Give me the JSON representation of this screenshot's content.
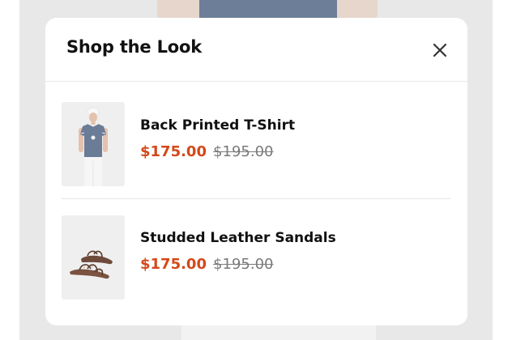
{
  "modal": {
    "title": "Shop the Look"
  },
  "products": [
    {
      "name": "Back Printed T-Shirt",
      "sale_price": "$175.00",
      "original_price": "$195.00"
    },
    {
      "name": "Studded Leather Sandals",
      "sale_price": "$175.00",
      "original_price": "$195.00"
    }
  ],
  "colors": {
    "sale_price": "#d4481a",
    "original_price": "#7a7a7a",
    "modal_background": "#ffffff",
    "backdrop": "#e8e8e8"
  },
  "icons": {
    "close": "close-icon"
  }
}
